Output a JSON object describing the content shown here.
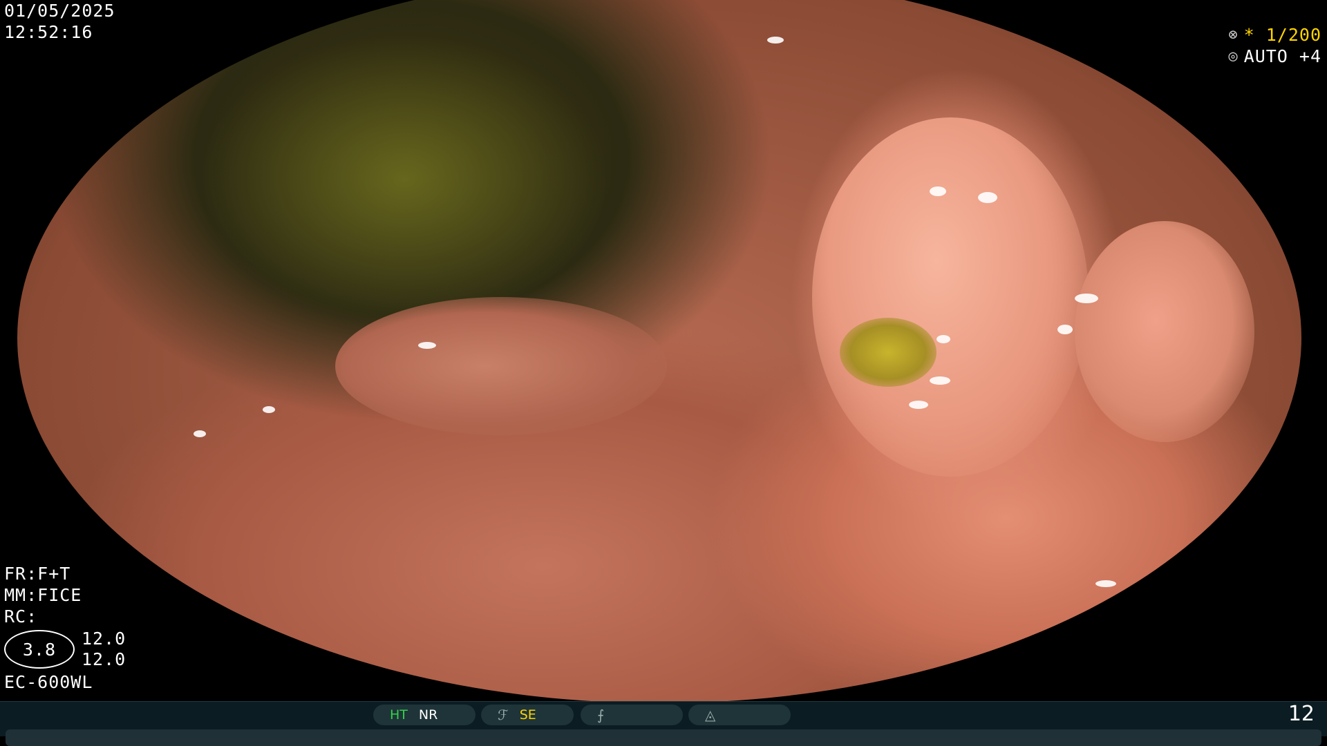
{
  "top_left": {
    "date": "01/05/2025",
    "time": "12:52:16"
  },
  "top_right": {
    "shutter_icon": "shutter-icon",
    "shutter_value": "* 1/200",
    "iris_icon": "iris-icon",
    "iris_value": "AUTO +4"
  },
  "bottom_left": {
    "fr": "FR:F+T",
    "mm": "MM:FICE",
    "rc": "RC:",
    "zoom": "3.8",
    "value_1": "12.0",
    "value_2": "12.0",
    "scope_model": "EC-600WL"
  },
  "status_bar": {
    "ht": "HT",
    "nr": "NR",
    "se": "SE",
    "frame_count": "12",
    "icons": [
      "tone-curve-icon",
      "edge-icon",
      "scope-mode-icon"
    ]
  },
  "colors": {
    "accent_yellow": "#ffd400",
    "ht_green": "#34d24a",
    "bar_bg": "#0b1c22"
  }
}
